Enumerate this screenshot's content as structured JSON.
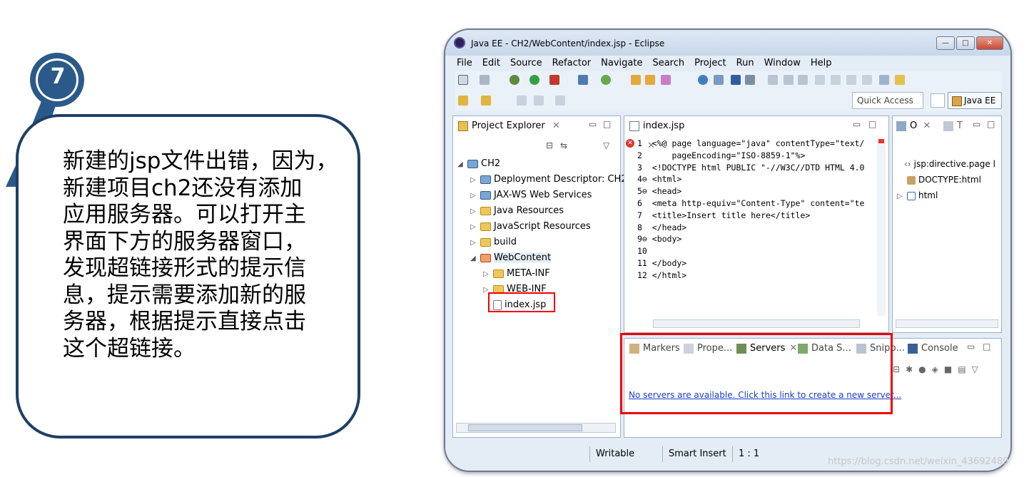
{
  "callout": {
    "step_number": "7",
    "text": "新建的jsp文件出错，因为，\n新建项目ch2还没有添加\n应用服务器。可以打开主\n界面下方的服务器窗口，\n发现超链接形式的提示信\n息，提示需要添加新的服\n务器，根据提示直接点击\n这个超链接。"
  },
  "window": {
    "title": "Java EE - CH2/WebContent/index.jsp - Eclipse",
    "minimize": "—",
    "maximize": "□",
    "close": "✕"
  },
  "menu": [
    "File",
    "Edit",
    "Source",
    "Refactor",
    "Navigate",
    "Search",
    "Project",
    "Run",
    "Window",
    "Help"
  ],
  "toolbar": {
    "quick_access": "Quick Access",
    "perspective": "Java EE"
  },
  "project_explorer": {
    "tab": "Project Explorer",
    "tree": [
      {
        "label": "CH2",
        "arrow": "◢",
        "indent": 0,
        "icon": "proj"
      },
      {
        "label": "Deployment Descriptor: CH2",
        "arrow": "▷",
        "indent": 1,
        "icon": "proj"
      },
      {
        "label": "JAX-WS Web Services",
        "arrow": "▷",
        "indent": 1,
        "icon": "proj"
      },
      {
        "label": "Java Resources",
        "arrow": "▷",
        "indent": 1,
        "icon": "folder"
      },
      {
        "label": "JavaScript Resources",
        "arrow": "▷",
        "indent": 1,
        "icon": "folder"
      },
      {
        "label": "build",
        "arrow": "▷",
        "indent": 1,
        "icon": "folder"
      },
      {
        "label": "WebContent",
        "arrow": "◢",
        "indent": 1,
        "icon": "folder red"
      },
      {
        "label": "META-INF",
        "arrow": "▷",
        "indent": 2,
        "icon": "folder"
      },
      {
        "label": "WEB-INF",
        "arrow": "▷",
        "indent": 2,
        "icon": "folder"
      },
      {
        "label": "index.jsp",
        "arrow": "",
        "indent": 2,
        "icon": "filei"
      }
    ]
  },
  "editor": {
    "tab": "index.jsp",
    "lines": [
      "1  <%@ page language=\"java\" contentType=\"text/",
      "2      pageEncoding=\"ISO-8859-1\"%>",
      "3  <!DOCTYPE html PUBLIC \"-//W3C//DTD HTML 4.0",
      "4⊖ <html>",
      "5⊖ <head>",
      "6  <meta http-equiv=\"Content-Type\" content=\"te",
      "7  <title>Insert title here</title>",
      "8  </head>",
      "9⊖ <body>",
      "10",
      "11 </body>",
      "12 </html>"
    ]
  },
  "outline": {
    "tabs": [
      "O",
      "T"
    ],
    "items": [
      "jsp:directive.page l",
      "DOCTYPE:html",
      "html"
    ]
  },
  "bottom_panel": {
    "tabs": [
      "Markers",
      "Prope...",
      "Servers",
      "Data S...",
      "Snipp...",
      "Console"
    ],
    "link": "No servers are available. Click this link to create a new server..."
  },
  "status": {
    "writable": "Writable",
    "insert_mode": "Smart Insert",
    "position": "1 : 1"
  },
  "watermark": "https://blog.csdn.net/weixin_43692489"
}
